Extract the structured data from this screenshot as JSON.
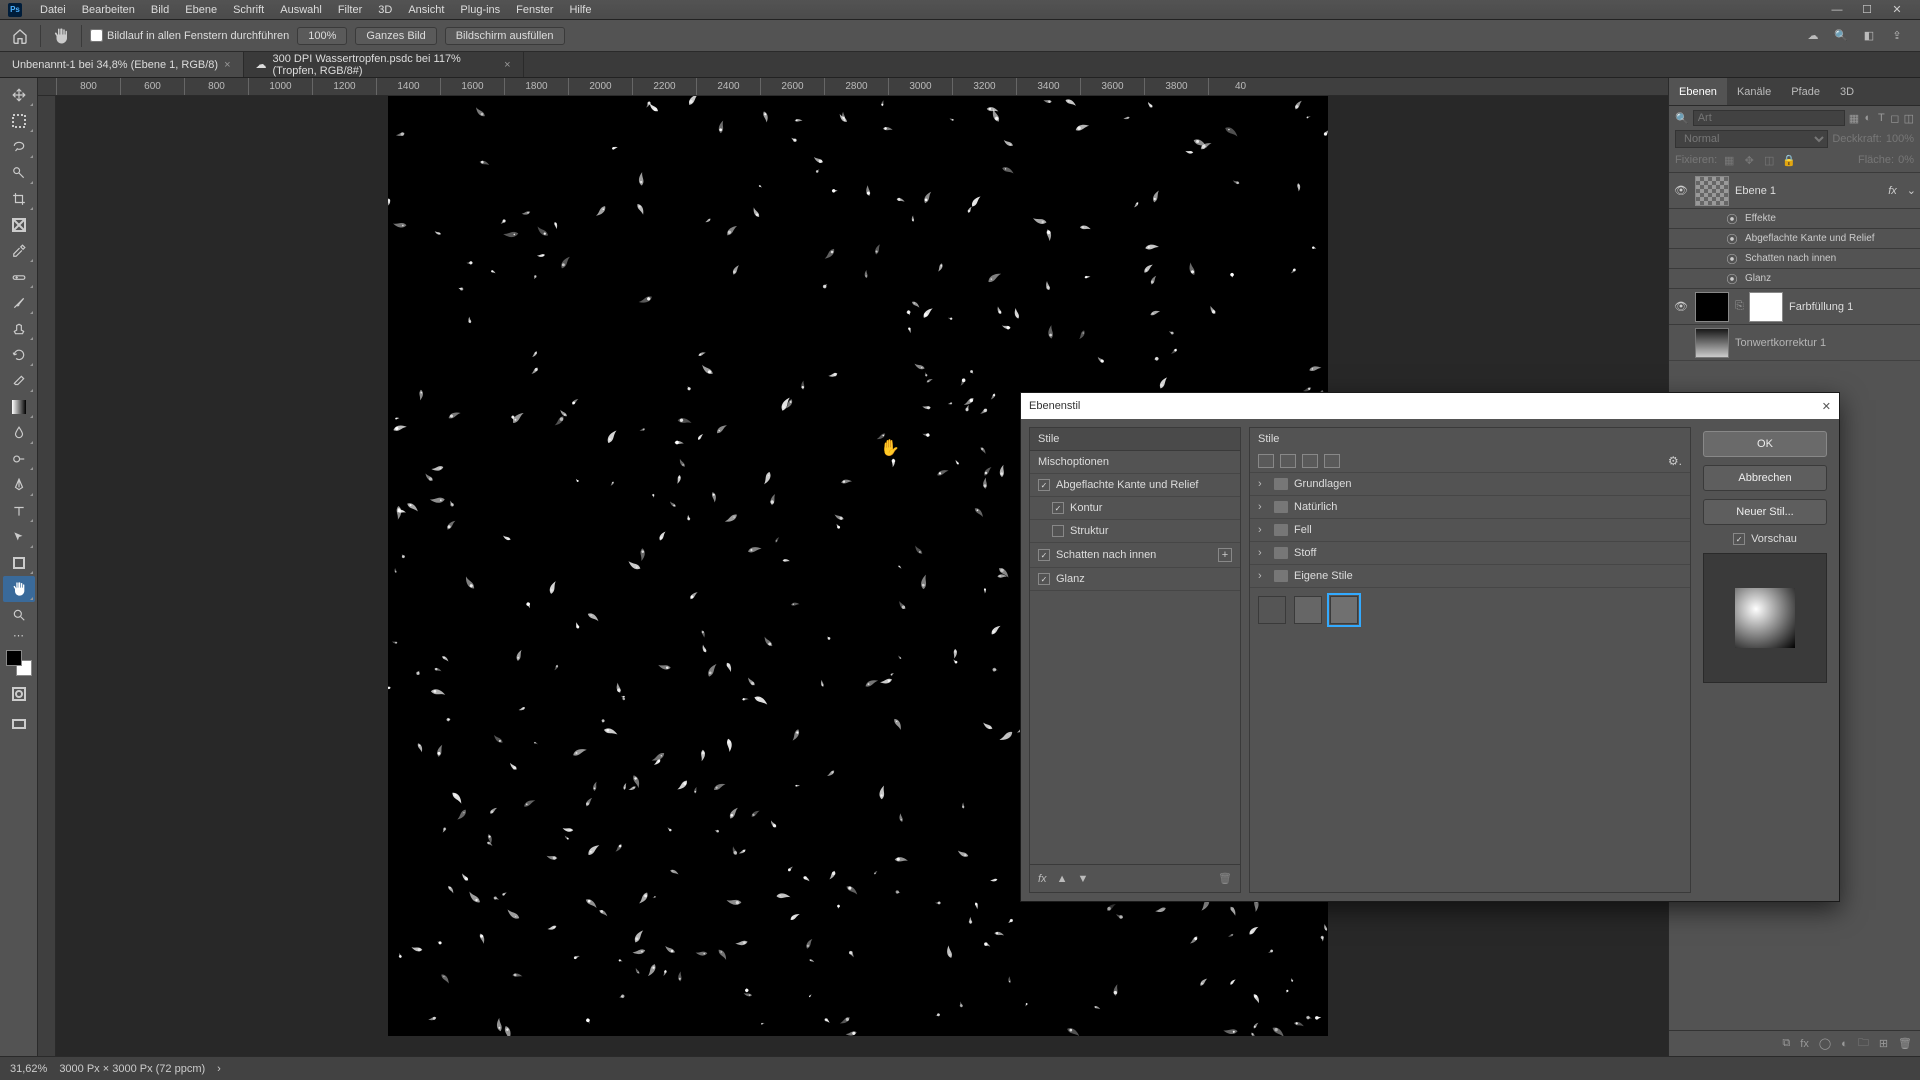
{
  "menu": [
    "Datei",
    "Bearbeiten",
    "Bild",
    "Ebene",
    "Schrift",
    "Auswahl",
    "Filter",
    "3D",
    "Ansicht",
    "Plug-ins",
    "Fenster",
    "Hilfe"
  ],
  "optbar": {
    "scroll_label": "Bildlauf in allen Fenstern durchführen",
    "b1": "100%",
    "b2": "Ganzes Bild",
    "b3": "Bildschirm ausfüllen"
  },
  "tabs": [
    {
      "label": "Unbenannt-1 bei 34,8% (Ebene 1, RGB/8)",
      "active": true
    },
    {
      "label": "300 DPI Wassertropfen.psdc bei 117% (Tropfen, RGB/8#)",
      "active": false
    }
  ],
  "ruler": [
    "800",
    "600",
    "800",
    "1000",
    "1200",
    "1400",
    "1600",
    "1800",
    "2000",
    "2200",
    "2400",
    "2600",
    "2800",
    "3000",
    "3200",
    "3400",
    "3600",
    "3800",
    "40"
  ],
  "panels": {
    "tabs": [
      "Ebenen",
      "Kanäle",
      "Pfade",
      "3D"
    ],
    "search_placeholder": "Art",
    "blend": "Normal",
    "opacity_label": "Deckkraft:",
    "opacity_val": "100%",
    "lock_label": "Fixieren:",
    "fill_label": "Fläche:",
    "fill_val": "0%"
  },
  "layers": {
    "l1": {
      "name": "Ebene 1",
      "fx": "fx"
    },
    "effects_header": "Effekte",
    "fx_items": [
      "Abgeflachte Kante und Relief",
      "Schatten nach innen",
      "Glanz"
    ],
    "l2": {
      "name": "Farbfüllung 1"
    },
    "l3": {
      "name": "Tonwertkorrektur 1"
    }
  },
  "status": {
    "zoom": "31,62%",
    "doc": "3000 Px × 3000 Px (72 ppcm)"
  },
  "dialog": {
    "title": "Ebenenstil",
    "left": {
      "hdr": "Stile",
      "items": [
        {
          "label": "Mischoptionen",
          "chk": null,
          "sub": false
        },
        {
          "label": "Abgeflachte Kante und Relief",
          "chk": true,
          "sub": false
        },
        {
          "label": "Kontur",
          "chk": true,
          "sub": true
        },
        {
          "label": "Struktur",
          "chk": false,
          "sub": true
        },
        {
          "label": "Schatten nach innen",
          "chk": true,
          "sub": false,
          "plus": true
        },
        {
          "label": "Glanz",
          "chk": true,
          "sub": false
        }
      ]
    },
    "mid": {
      "hdr": "Stile",
      "folders": [
        "Grundlagen",
        "Natürlich",
        "Fell",
        "Stoff",
        "Eigene Stile"
      ]
    },
    "right": {
      "ok": "OK",
      "cancel": "Abbrechen",
      "new": "Neuer Stil...",
      "preview": "Vorschau"
    }
  }
}
